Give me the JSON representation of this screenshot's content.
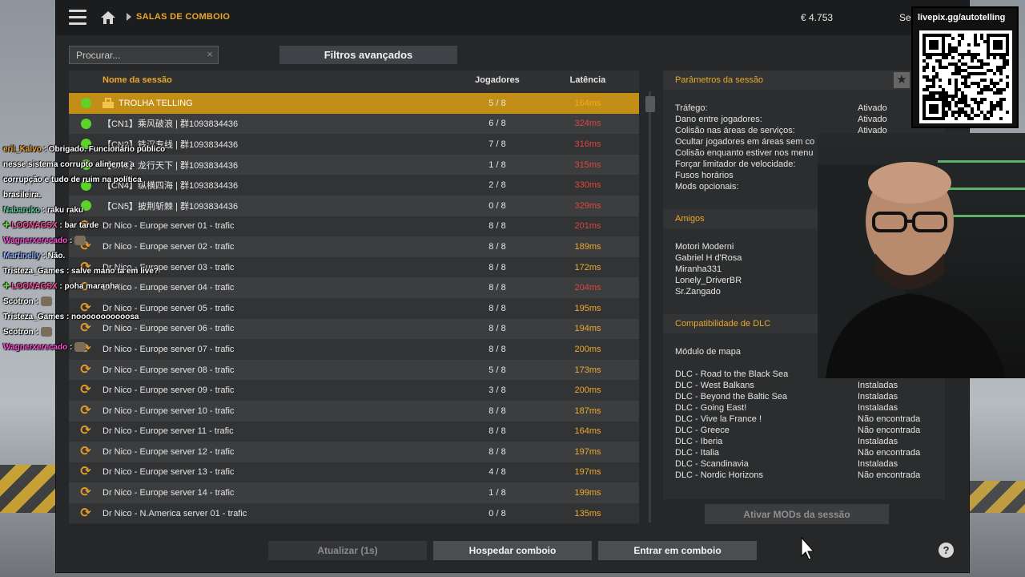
{
  "topbar": {
    "breadcrumb": "SALAS DE COMBOIO",
    "money": "€ 4.753",
    "session_label": "Se"
  },
  "search": {
    "placeholder": "Procurar...",
    "value": "",
    "clear": "×"
  },
  "filters_button": "Filtros avançados",
  "table": {
    "headers": {
      "name": "Nome da sessão",
      "players": "Jogadores",
      "latency": "Latência"
    },
    "rows": [
      {
        "status": "locked",
        "name": "TROLHA TELLING",
        "players": "5 / 8",
        "latency": "164ms",
        "lat_color": "#f0a830",
        "selected": true
      },
      {
        "status": "online",
        "name": "【CN1】乘风破浪 | 群1093834436",
        "players": "6 / 8",
        "latency": "324ms",
        "lat_color": "#e0463a"
      },
      {
        "status": "online",
        "name": "【CN2】铁汉专线 | 群1093834436",
        "players": "7 / 8",
        "latency": "316ms",
        "lat_color": "#e0463a"
      },
      {
        "status": "online",
        "name": "【CN3】龙行天下 | 群1093834436",
        "players": "1 / 8",
        "latency": "315ms",
        "lat_color": "#e0463a"
      },
      {
        "status": "online",
        "name": "【CN4】纵横四海 | 群1093834436",
        "players": "2 / 8",
        "latency": "330ms",
        "lat_color": "#e0463a"
      },
      {
        "status": "online",
        "name": "【CN5】披荆斩棘 | 群1093834436",
        "players": "0 / 8",
        "latency": "329ms",
        "lat_color": "#e0463a"
      },
      {
        "status": "sync",
        "name": "Dr Nico - Europe server 01 - trafic",
        "players": "8 / 8",
        "latency": "201ms",
        "lat_color": "#e0463a"
      },
      {
        "status": "sync",
        "name": "Dr Nico - Europe server 02 - trafic",
        "players": "8 / 8",
        "latency": "189ms",
        "lat_color": "#f0a830"
      },
      {
        "status": "sync",
        "name": "Dr Nico - Europe server 03 - trafic",
        "players": "8 / 8",
        "latency": "172ms",
        "lat_color": "#f0a830"
      },
      {
        "status": "sync",
        "name": "Dr Nico - Europe server 04 - trafic",
        "players": "8 / 8",
        "latency": "204ms",
        "lat_color": "#e0463a"
      },
      {
        "status": "sync",
        "name": "Dr Nico - Europe server 05 - trafic",
        "players": "8 / 8",
        "latency": "195ms",
        "lat_color": "#f0a830"
      },
      {
        "status": "sync",
        "name": "Dr Nico - Europe server 06 - trafic",
        "players": "8 / 8",
        "latency": "194ms",
        "lat_color": "#f0a830"
      },
      {
        "status": "sync",
        "name": "Dr Nico - Europe server 07 - trafic",
        "players": "8 / 8",
        "latency": "200ms",
        "lat_color": "#f0a830"
      },
      {
        "status": "sync",
        "name": "Dr Nico - Europe server 08 - trafic",
        "players": "5 / 8",
        "latency": "173ms",
        "lat_color": "#f0a830"
      },
      {
        "status": "sync",
        "name": "Dr Nico - Europe server 09 - trafic",
        "players": "3 / 8",
        "latency": "200ms",
        "lat_color": "#f0a830"
      },
      {
        "status": "sync",
        "name": "Dr Nico - Europe server 10 - trafic",
        "players": "8 / 8",
        "latency": "187ms",
        "lat_color": "#f0a830"
      },
      {
        "status": "sync",
        "name": "Dr Nico - Europe server 11 - trafic",
        "players": "8 / 8",
        "latency": "164ms",
        "lat_color": "#f0a830"
      },
      {
        "status": "sync",
        "name": "Dr Nico - Europe server 12 - trafic",
        "players": "8 / 8",
        "latency": "197ms",
        "lat_color": "#f0a830"
      },
      {
        "status": "sync",
        "name": "Dr Nico - Europe server 13 - trafic",
        "players": "4 / 8",
        "latency": "197ms",
        "lat_color": "#f0a830"
      },
      {
        "status": "sync",
        "name": "Dr Nico - Europe server 14 - trafic",
        "players": "1 / 8",
        "latency": "199ms",
        "lat_color": "#f0a830"
      },
      {
        "status": "sync",
        "name": "Dr Nico - N.America server 01 - trafic",
        "players": "0 / 8",
        "latency": "135ms",
        "lat_color": "#f0a830"
      }
    ]
  },
  "panel": {
    "params_title": "Parâmetros da sessão",
    "star": "★",
    "params": [
      {
        "k": "Tráfego:",
        "v": "Ativado"
      },
      {
        "k": "Dano entre jogadores:",
        "v": "Ativado"
      },
      {
        "k": "Colisão nas áreas de serviços:",
        "v": "Ativado"
      },
      {
        "k": "Ocultar jogadores em áreas sem co",
        "v": ""
      },
      {
        "k": "Colisão enquanto estiver nos menu",
        "v": ""
      },
      {
        "k": "Forçar limitador de velocidade:",
        "v": ""
      },
      {
        "k": "Fusos horários",
        "v": ""
      },
      {
        "k": "Mods opcionais:",
        "v": ""
      }
    ],
    "friends_title": "Amigos",
    "friends": [
      "Motori Moderni",
      "Gabriel H d'Rosa",
      "Miranha331",
      "Lonely_DriverBR",
      "Sr.Zangado"
    ],
    "dlc_title": "Compatibilidade de DLC",
    "map_module": "Módulo de mapa",
    "dlcs": [
      {
        "k": "DLC - Road to the Black Sea",
        "v": ""
      },
      {
        "k": "DLC - West Balkans",
        "v": "Instaladas"
      },
      {
        "k": "DLC - Beyond the Baltic Sea",
        "v": "Instaladas"
      },
      {
        "k": "DLC - Going East!",
        "v": "Instaladas"
      },
      {
        "k": "DLC - Vive la France !",
        "v": "Não encontrada"
      },
      {
        "k": "DLC - Greece",
        "v": "Não encontrada"
      },
      {
        "k": "DLC - Iberia",
        "v": "Instaladas"
      },
      {
        "k": "DLC - Italia",
        "v": "Não encontrada"
      },
      {
        "k": "DLC - Scandinavia",
        "v": "Instaladas"
      },
      {
        "k": "DLC - Nordic Horizons",
        "v": "Não encontrada"
      }
    ],
    "activate_mods": "Ativar MODs da sessão"
  },
  "buttons": {
    "refresh": "Atualizar (1s)",
    "host": "Hospedar comboio",
    "join": "Entrar em comboio",
    "help": "?"
  },
  "chat": [
    {
      "user": "eril_Kalvo",
      "color": "#f0a830",
      "badge": "",
      "text": ": Obrigado. Funcionário público"
    },
    {
      "user": "",
      "color": "#fff",
      "badge": "",
      "text": "nesse sistema corrupto alimenta a"
    },
    {
      "user": "",
      "color": "#fff",
      "badge": "",
      "text": "corrupção e tudo de ruim na política"
    },
    {
      "user": "",
      "color": "#fff",
      "badge": "",
      "text": "brasileira."
    },
    {
      "user": "Nabaruko",
      "color": "#5fd1a0",
      "badge": "",
      "text": ": raku raku"
    },
    {
      "user": "LOONAGSX",
      "color": "#ff4fa0",
      "badge": "✚",
      "text": ": bar tarde"
    },
    {
      "user": "Wagnerxerecado",
      "color": "#ff4fd8",
      "badge": "",
      "text": ":"
    },
    {
      "user": "Martinelly",
      "color": "#8fb4ff",
      "badge": "",
      "text": ": Não."
    },
    {
      "user": "Tristeza_Games",
      "color": "#ffffff",
      "badge": "",
      "text": ": salve mano ta em live?"
    },
    {
      "user": "LOONAGSX",
      "color": "#ff4fa0",
      "badge": "✚",
      "text": ": poha maranha"
    },
    {
      "user": "Scotron",
      "color": "#ffffff",
      "badge": "",
      "text": ":"
    },
    {
      "user": "Tristeza_Games",
      "color": "#ffffff",
      "badge": "",
      "text": ": nooooooooooosa"
    },
    {
      "user": "Scotron",
      "color": "#ffffff",
      "badge": "",
      "text": ":"
    },
    {
      "user": "Wagnerxerecado",
      "color": "#ff4fd8",
      "badge": "",
      "text": ":"
    }
  ],
  "overlay": {
    "qr_label": "livepix.gg/autotelling"
  }
}
